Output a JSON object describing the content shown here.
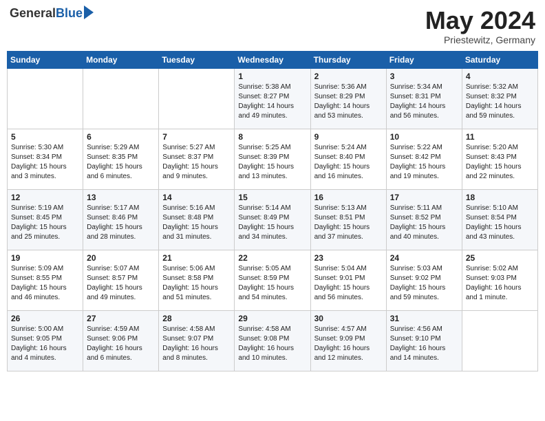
{
  "header": {
    "logo_general": "General",
    "logo_blue": "Blue",
    "month_year": "May 2024",
    "location": "Priestewitz, Germany"
  },
  "days_of_week": [
    "Sunday",
    "Monday",
    "Tuesday",
    "Wednesday",
    "Thursday",
    "Friday",
    "Saturday"
  ],
  "weeks": [
    [
      {
        "day": "",
        "info": ""
      },
      {
        "day": "",
        "info": ""
      },
      {
        "day": "",
        "info": ""
      },
      {
        "day": "1",
        "info": "Sunrise: 5:38 AM\nSunset: 8:27 PM\nDaylight: 14 hours\nand 49 minutes."
      },
      {
        "day": "2",
        "info": "Sunrise: 5:36 AM\nSunset: 8:29 PM\nDaylight: 14 hours\nand 53 minutes."
      },
      {
        "day": "3",
        "info": "Sunrise: 5:34 AM\nSunset: 8:31 PM\nDaylight: 14 hours\nand 56 minutes."
      },
      {
        "day": "4",
        "info": "Sunrise: 5:32 AM\nSunset: 8:32 PM\nDaylight: 14 hours\nand 59 minutes."
      }
    ],
    [
      {
        "day": "5",
        "info": "Sunrise: 5:30 AM\nSunset: 8:34 PM\nDaylight: 15 hours\nand 3 minutes."
      },
      {
        "day": "6",
        "info": "Sunrise: 5:29 AM\nSunset: 8:35 PM\nDaylight: 15 hours\nand 6 minutes."
      },
      {
        "day": "7",
        "info": "Sunrise: 5:27 AM\nSunset: 8:37 PM\nDaylight: 15 hours\nand 9 minutes."
      },
      {
        "day": "8",
        "info": "Sunrise: 5:25 AM\nSunset: 8:39 PM\nDaylight: 15 hours\nand 13 minutes."
      },
      {
        "day": "9",
        "info": "Sunrise: 5:24 AM\nSunset: 8:40 PM\nDaylight: 15 hours\nand 16 minutes."
      },
      {
        "day": "10",
        "info": "Sunrise: 5:22 AM\nSunset: 8:42 PM\nDaylight: 15 hours\nand 19 minutes."
      },
      {
        "day": "11",
        "info": "Sunrise: 5:20 AM\nSunset: 8:43 PM\nDaylight: 15 hours\nand 22 minutes."
      }
    ],
    [
      {
        "day": "12",
        "info": "Sunrise: 5:19 AM\nSunset: 8:45 PM\nDaylight: 15 hours\nand 25 minutes."
      },
      {
        "day": "13",
        "info": "Sunrise: 5:17 AM\nSunset: 8:46 PM\nDaylight: 15 hours\nand 28 minutes."
      },
      {
        "day": "14",
        "info": "Sunrise: 5:16 AM\nSunset: 8:48 PM\nDaylight: 15 hours\nand 31 minutes."
      },
      {
        "day": "15",
        "info": "Sunrise: 5:14 AM\nSunset: 8:49 PM\nDaylight: 15 hours\nand 34 minutes."
      },
      {
        "day": "16",
        "info": "Sunrise: 5:13 AM\nSunset: 8:51 PM\nDaylight: 15 hours\nand 37 minutes."
      },
      {
        "day": "17",
        "info": "Sunrise: 5:11 AM\nSunset: 8:52 PM\nDaylight: 15 hours\nand 40 minutes."
      },
      {
        "day": "18",
        "info": "Sunrise: 5:10 AM\nSunset: 8:54 PM\nDaylight: 15 hours\nand 43 minutes."
      }
    ],
    [
      {
        "day": "19",
        "info": "Sunrise: 5:09 AM\nSunset: 8:55 PM\nDaylight: 15 hours\nand 46 minutes."
      },
      {
        "day": "20",
        "info": "Sunrise: 5:07 AM\nSunset: 8:57 PM\nDaylight: 15 hours\nand 49 minutes."
      },
      {
        "day": "21",
        "info": "Sunrise: 5:06 AM\nSunset: 8:58 PM\nDaylight: 15 hours\nand 51 minutes."
      },
      {
        "day": "22",
        "info": "Sunrise: 5:05 AM\nSunset: 8:59 PM\nDaylight: 15 hours\nand 54 minutes."
      },
      {
        "day": "23",
        "info": "Sunrise: 5:04 AM\nSunset: 9:01 PM\nDaylight: 15 hours\nand 56 minutes."
      },
      {
        "day": "24",
        "info": "Sunrise: 5:03 AM\nSunset: 9:02 PM\nDaylight: 15 hours\nand 59 minutes."
      },
      {
        "day": "25",
        "info": "Sunrise: 5:02 AM\nSunset: 9:03 PM\nDaylight: 16 hours\nand 1 minute."
      }
    ],
    [
      {
        "day": "26",
        "info": "Sunrise: 5:00 AM\nSunset: 9:05 PM\nDaylight: 16 hours\nand 4 minutes."
      },
      {
        "day": "27",
        "info": "Sunrise: 4:59 AM\nSunset: 9:06 PM\nDaylight: 16 hours\nand 6 minutes."
      },
      {
        "day": "28",
        "info": "Sunrise: 4:58 AM\nSunset: 9:07 PM\nDaylight: 16 hours\nand 8 minutes."
      },
      {
        "day": "29",
        "info": "Sunrise: 4:58 AM\nSunset: 9:08 PM\nDaylight: 16 hours\nand 10 minutes."
      },
      {
        "day": "30",
        "info": "Sunrise: 4:57 AM\nSunset: 9:09 PM\nDaylight: 16 hours\nand 12 minutes."
      },
      {
        "day": "31",
        "info": "Sunrise: 4:56 AM\nSunset: 9:10 PM\nDaylight: 16 hours\nand 14 minutes."
      },
      {
        "day": "",
        "info": ""
      }
    ]
  ]
}
